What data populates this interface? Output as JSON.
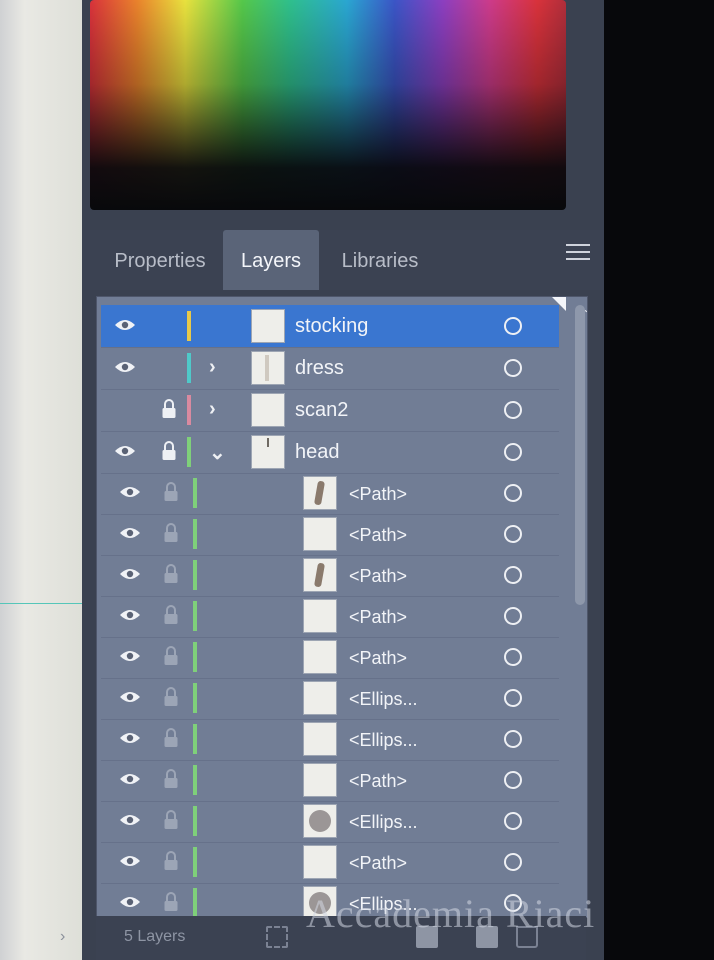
{
  "tabs": [
    {
      "label": "Properties",
      "active": false
    },
    {
      "label": "Layers",
      "active": true
    },
    {
      "label": "Libraries",
      "active": false
    }
  ],
  "panel_menu_icon": "hamburger-icon",
  "layers": [
    {
      "name": "stocking",
      "visible": true,
      "locked": false,
      "color": "#e8c94a",
      "expander": "",
      "selected": true,
      "thumb": "blank"
    },
    {
      "name": "dress",
      "visible": true,
      "locked": false,
      "color": "#4fc9c9",
      "expander": "›",
      "selected": false,
      "thumb": "fig"
    },
    {
      "name": "scan2",
      "visible": false,
      "locked": true,
      "color": "#d98aa0",
      "expander": "›",
      "selected": false,
      "thumb": "blank"
    },
    {
      "name": "head",
      "visible": true,
      "locked": true,
      "color": "#7fd07a",
      "expander": "⌄",
      "selected": false,
      "thumb": "tick"
    }
  ],
  "sublayers": [
    {
      "name": "<Path>",
      "thumb": "stroke"
    },
    {
      "name": "<Path>",
      "thumb": "blank"
    },
    {
      "name": "<Path>",
      "thumb": "stroke"
    },
    {
      "name": "<Path>",
      "thumb": "blank"
    },
    {
      "name": "<Path>",
      "thumb": "blank"
    },
    {
      "name": "<Ellips...",
      "thumb": "blank"
    },
    {
      "name": "<Ellips...",
      "thumb": "blank"
    },
    {
      "name": "<Path>",
      "thumb": "blank"
    },
    {
      "name": "<Ellips...",
      "thumb": "dot"
    },
    {
      "name": "<Path>",
      "thumb": "blank"
    },
    {
      "name": "<Ellips...",
      "thumb": "dot"
    }
  ],
  "footer": {
    "layer_count": "5 Layers"
  },
  "watermark": "Accademia Riaci"
}
